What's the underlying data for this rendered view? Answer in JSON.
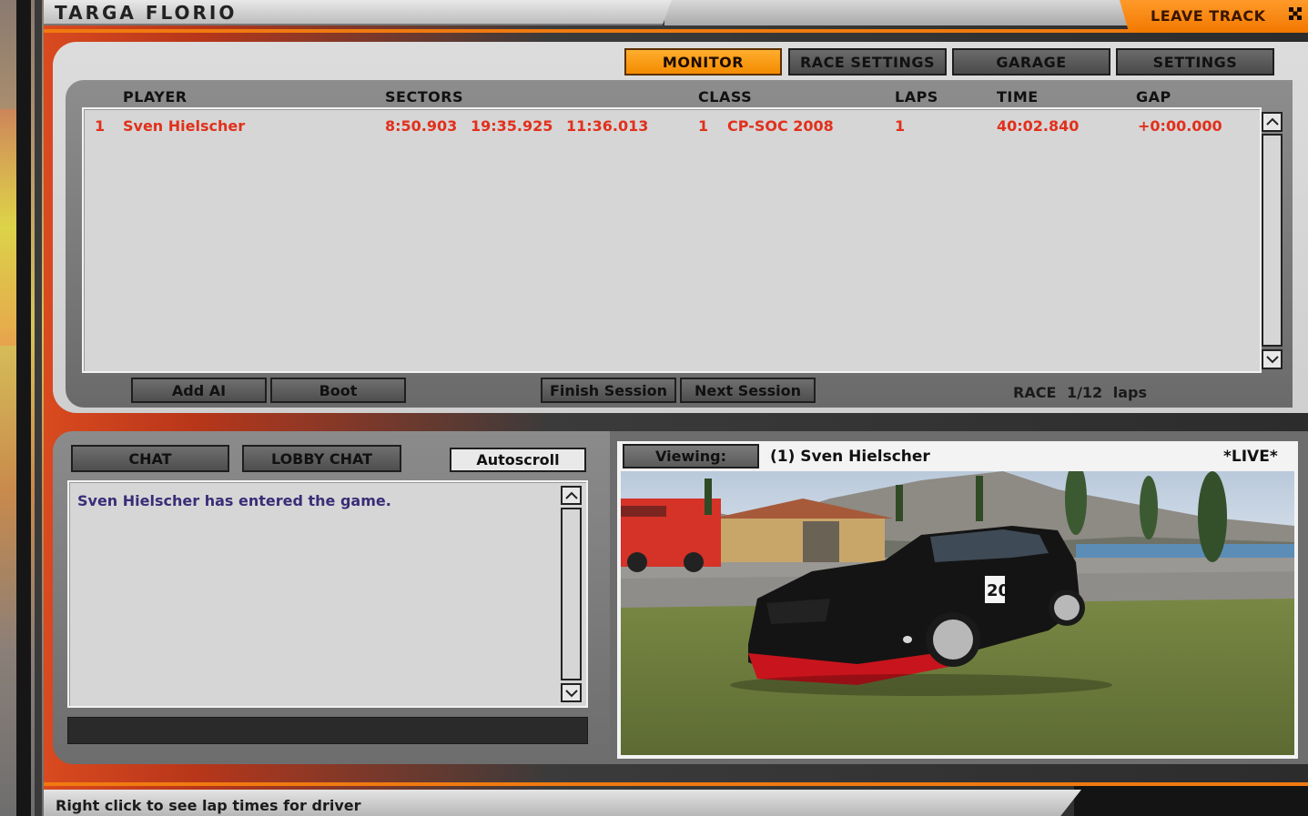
{
  "window": {
    "title": "TARGA FLORIO",
    "leave_track_label": "LEAVE TRACK",
    "close_icon": "close-icon"
  },
  "tabs": [
    {
      "label": "MONITOR",
      "active": true
    },
    {
      "label": "RACE SETTINGS",
      "active": false
    },
    {
      "label": "GARAGE",
      "active": false
    },
    {
      "label": "SETTINGS",
      "active": false
    }
  ],
  "standings": {
    "columns": {
      "player": "PLAYER",
      "sectors": "SECTORS",
      "class": "CLASS",
      "laps": "LAPS",
      "time": "TIME",
      "gap": "GAP"
    },
    "rows": [
      {
        "position": "1",
        "player": "Sven Hielscher",
        "sector1": "8:50.903",
        "sector2": "19:35.925",
        "sector3": "11:36.013",
        "class_pos": "1",
        "class_name": "CP-SOC 2008",
        "laps": "1",
        "time": "40:02.840",
        "gap": "+0:00.000"
      }
    ]
  },
  "session_buttons": {
    "add_ai": "Add AI",
    "boot": "Boot",
    "finish_session": "Finish Session",
    "next_session": "Next Session"
  },
  "session_info": "RACE 1/12 laps",
  "chat": {
    "chat_tab": "CHAT",
    "lobby_chat_tab": "LOBBY CHAT",
    "autoscroll": "Autoscroll",
    "messages": [
      "Sven Hielscher has entered the game."
    ],
    "input_value": ""
  },
  "viewer": {
    "viewing_label": "Viewing:",
    "driver": "(1) Sven Hielscher",
    "live": "*LIVE*",
    "car_number": "20"
  },
  "status_bar": {
    "text": "Right click to see lap times for driver"
  },
  "colors": {
    "accent_orange": "#f38b00",
    "row_text_red": "#e1301c",
    "chat_text_purple": "#3a2d78"
  }
}
